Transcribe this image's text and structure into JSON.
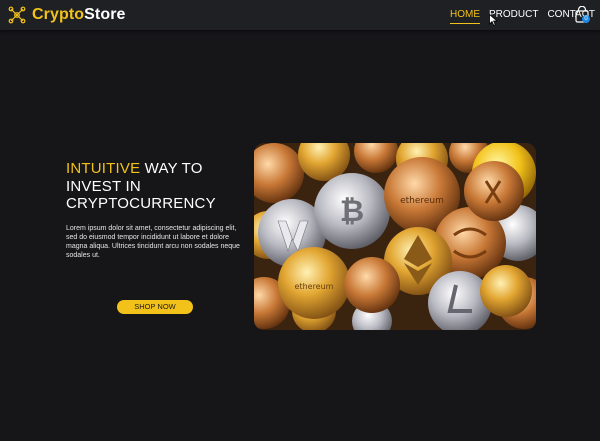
{
  "brand": {
    "part1": "Crypto",
    "part2": "Store",
    "icon": "network-nodes-icon"
  },
  "nav": {
    "links": [
      {
        "label": "HOME",
        "active": true
      },
      {
        "label": "PRODUCT",
        "active": false
      },
      {
        "label": "CONTACT",
        "active": false
      }
    ],
    "cart_icon": "shopping-bag-icon",
    "cart_count": "0"
  },
  "hero": {
    "title_highlight": "INTUITIVE",
    "title_rest_line1": " WAY TO",
    "title_line2": "INVEST IN",
    "title_line3": "CRYPTOCURRENCY",
    "description": "Lorem ipsum dolor sit amet, consectetur adipiscing elit, sed do eiusmod tempor incididunt ut labore et dolore magna aliqua. Ultrices tincidunt arcu non sodales neque sodales ut.",
    "button_label": "SHOP NOW",
    "coin_labels": {
      "ethereum": "ethereum"
    }
  },
  "colors": {
    "accent": "#f2c21a",
    "background": "#161518",
    "navbar": "#1f2023",
    "badge": "#1e88e5"
  }
}
